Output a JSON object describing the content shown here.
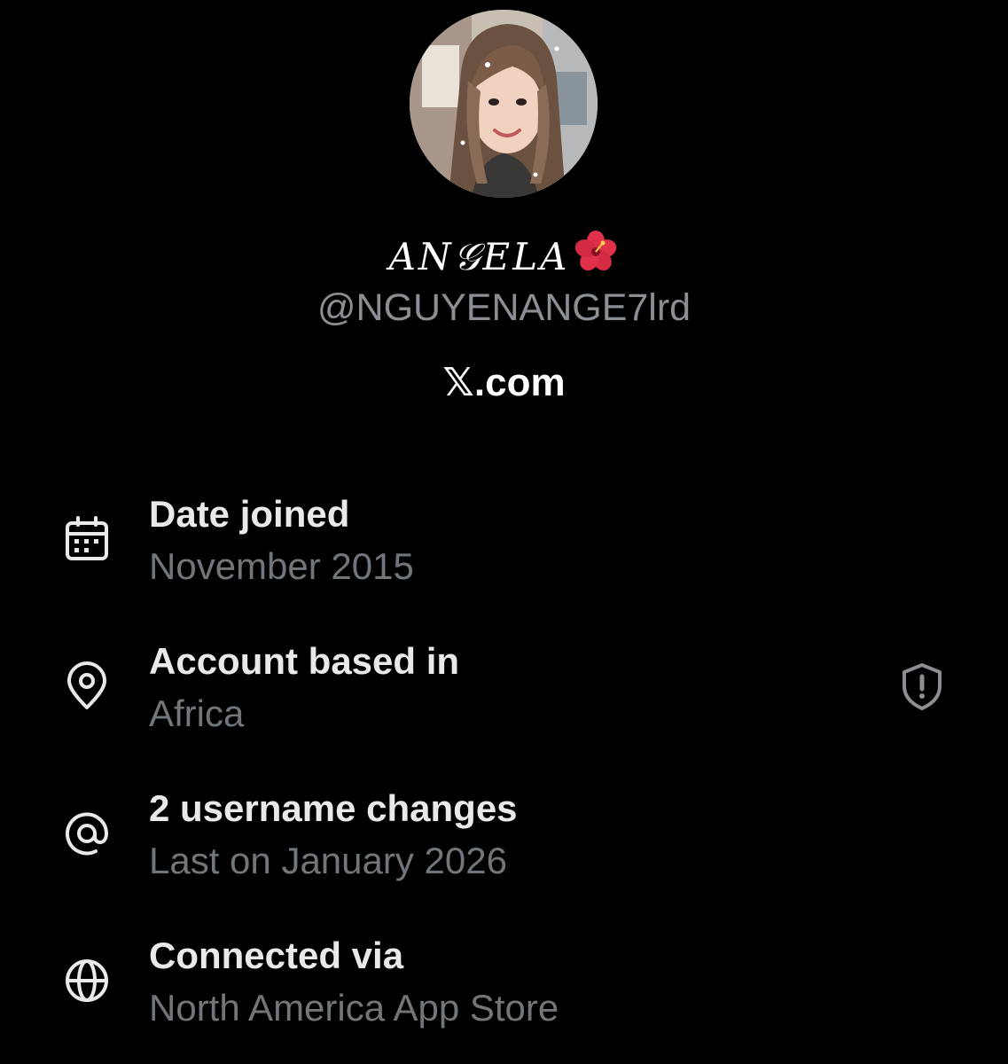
{
  "profile": {
    "avatar_icon": "profile-photo",
    "display_name": "𝐴𝑁𝒢𝐸𝐿𝐴",
    "display_name_emoji": "hibiscus-icon",
    "handle": "@NGUYENANGE7lrd",
    "site_label": "𝕏.com"
  },
  "rows": [
    {
      "icon": "calendar-icon",
      "title": "Date joined",
      "value": "November 2015"
    },
    {
      "icon": "location-pin-icon",
      "title": "Account based in",
      "value": "Africa",
      "trailing_icon": "shield-alert-icon"
    },
    {
      "icon": "at-sign-icon",
      "title": "2 username changes",
      "value": "Last on January 2026"
    },
    {
      "icon": "globe-icon",
      "title": "Connected via",
      "value": "North America App Store"
    }
  ],
  "colors": {
    "background": "#000000",
    "primary_text": "#e7e9ea",
    "secondary_text": "#71767b",
    "handle_text": "#8b8f94"
  }
}
